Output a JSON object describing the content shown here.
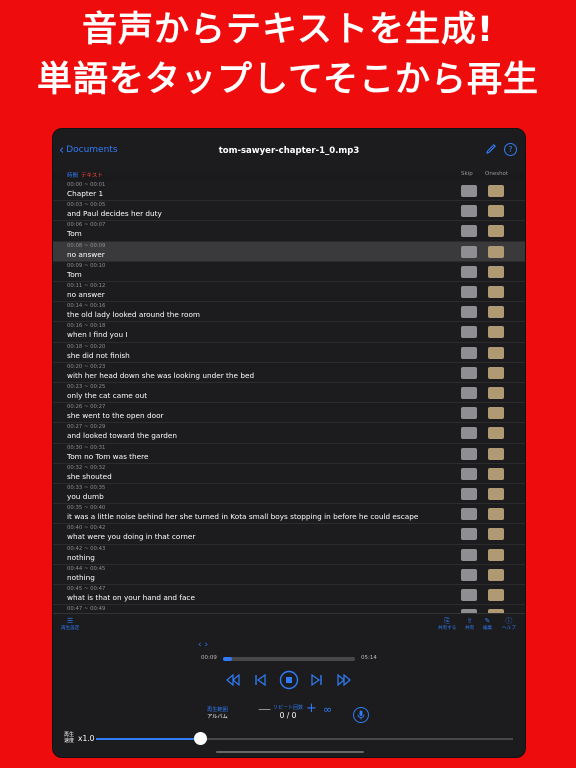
{
  "headline": {
    "line1": "音声からテキストを生成!",
    "line2": "単語をタップしてそこから再生"
  },
  "colors": {
    "accent": "#2f7cf6",
    "oneshot": "#b09a74",
    "skip": "#8e8e93",
    "red_label": "#ff453a"
  },
  "navbar": {
    "back_label": "Documents",
    "title": "tom-sawyer-chapter-1_0.mp3",
    "help": "?"
  },
  "columns": {
    "time": "時間",
    "text": "テキスト",
    "skip": "Skip",
    "oneshot": "Oneshot"
  },
  "rows": [
    {
      "time": "00:00 ~ 00:01",
      "text": "Chapter 1"
    },
    {
      "time": "00:03 ~ 00:05",
      "text": "and Paul decides her duty"
    },
    {
      "time": "00:06 ~ 00:07",
      "text": "Tom"
    },
    {
      "time": "00:08 ~ 00:09",
      "text": "no answer"
    },
    {
      "time": "00:09 ~ 00:10",
      "text": "Tom"
    },
    {
      "time": "00:11 ~ 00:12",
      "text": "no answer"
    },
    {
      "time": "00:14 ~ 00:16",
      "text": "the old lady looked around the room"
    },
    {
      "time": "00:16 ~ 00:18",
      "text": "when I find you I"
    },
    {
      "time": "00:18 ~ 00:20",
      "text": "she did not finish"
    },
    {
      "time": "00:20 ~ 00:23",
      "text": "with her head down she was looking under the bed"
    },
    {
      "time": "00:23 ~ 00:25",
      "text": "only the cat came out"
    },
    {
      "time": "00:26 ~ 00:27",
      "text": "she went to the open door"
    },
    {
      "time": "00:27 ~ 00:29",
      "text": "and looked toward the garden"
    },
    {
      "time": "00:30 ~ 00:31",
      "text": "Tom no Tom was there"
    },
    {
      "time": "00:32 ~ 00:32",
      "text": "she shouted"
    },
    {
      "time": "00:33 ~ 00:35",
      "text": "you dumb"
    },
    {
      "time": "00:35 ~ 00:40",
      "text": "it was a little noise behind her she turned in Kota small boys stopping in before he could escape"
    },
    {
      "time": "00:40 ~ 00:42",
      "text": "what were you doing in that corner"
    },
    {
      "time": "00:42 ~ 00:43",
      "text": "nothing"
    },
    {
      "time": "00:44 ~ 00:45",
      "text": "nothing"
    },
    {
      "time": "00:45 ~ 00:47",
      "text": "what is that on your hand and face"
    },
    {
      "time": "00:47 ~ 00:49",
      "text": ""
    }
  ],
  "selected_row": 3,
  "toolbar": {
    "settings": "再生設定",
    "share_dl": "共有する",
    "share": "共有",
    "edit": "編集",
    "help": "ヘルプ"
  },
  "player": {
    "elapsed": "00:09",
    "total": "05:14",
    "progress": 0.07,
    "mode_label": "再生範囲",
    "mode_value": "アルバム",
    "repeat_label": "リピート回数",
    "repeat_value": "0 / 0",
    "minus": "—",
    "plus": "+",
    "infinity": "∞",
    "speed_label": "再生速度",
    "speed_value": "x1.0",
    "speed_fraction": 0.25
  }
}
